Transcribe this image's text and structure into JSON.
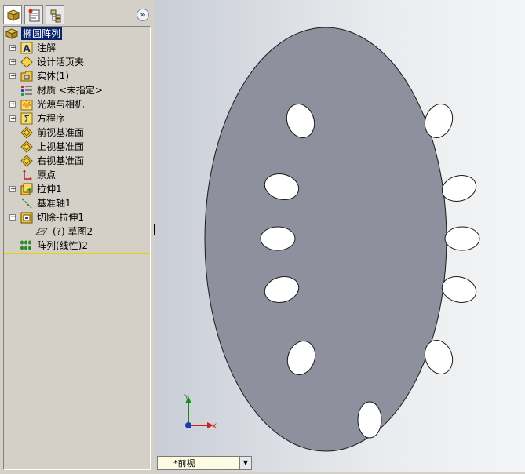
{
  "tabs": [
    {
      "name": "feature-manager",
      "icon": "feature-tree-icon"
    },
    {
      "name": "property-manager",
      "icon": "property-manager-icon"
    },
    {
      "name": "configuration-manager",
      "icon": "configuration-manager-icon"
    }
  ],
  "expand_glyph": "»",
  "tree": {
    "root": "椭圆阵列",
    "items": [
      {
        "label": "注解",
        "icon": "annotations-icon",
        "expander": "+"
      },
      {
        "label": "设计活页夹",
        "icon": "design-binder-icon",
        "expander": "+"
      },
      {
        "label": "实体(1)",
        "icon": "solid-bodies-icon",
        "expander": "+"
      },
      {
        "label": "材质 <未指定>",
        "icon": "material-icon",
        "expander": ""
      },
      {
        "label": "光源与相机",
        "icon": "lights-cameras-icon",
        "expander": "+"
      },
      {
        "label": "方程序",
        "icon": "equations-icon",
        "expander": "+"
      },
      {
        "label": "前视基准面",
        "icon": "plane-icon",
        "expander": ""
      },
      {
        "label": "上视基准面",
        "icon": "plane-icon",
        "expander": ""
      },
      {
        "label": "右视基准面",
        "icon": "plane-icon",
        "expander": ""
      },
      {
        "label": "原点",
        "icon": "origin-icon",
        "expander": ""
      },
      {
        "label": "拉伸1",
        "icon": "extrude-icon",
        "expander": "+"
      },
      {
        "label": "基准轴1",
        "icon": "axis-icon",
        "expander": ""
      },
      {
        "label": "切除-拉伸1",
        "icon": "cut-extrude-icon",
        "expander": "−"
      },
      {
        "label": "(?) 草图2",
        "icon": "sketch-icon",
        "expander": ""
      },
      {
        "label": "阵列(线性)2",
        "icon": "linear-pattern-icon",
        "expander": ""
      }
    ]
  },
  "viewport": {
    "part_color": "#8e919d",
    "background_top": "#c9cdd6",
    "triad": {
      "x_label": "X",
      "y_label": "Y"
    }
  },
  "status": {
    "view_name": "*前视",
    "dropdown_glyph": "▼"
  }
}
